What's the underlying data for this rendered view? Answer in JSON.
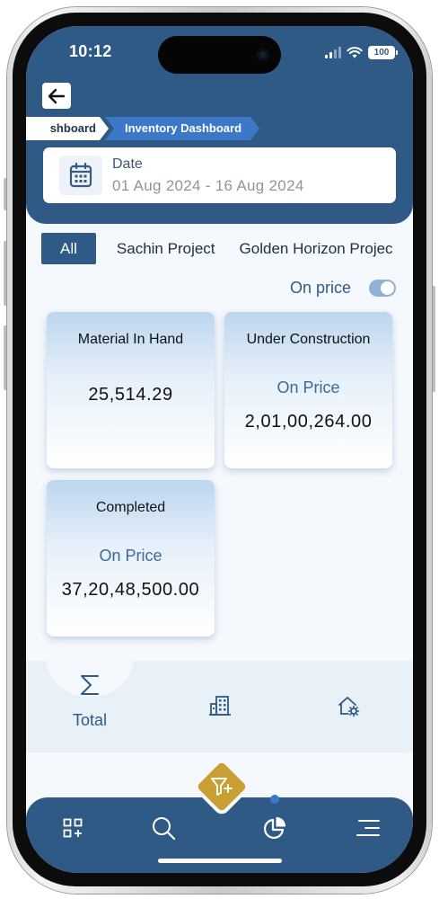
{
  "status_bar": {
    "time": "10:12",
    "battery": "100"
  },
  "breadcrumbs": {
    "previous": "shboard",
    "current": "Inventory Dashboard"
  },
  "date_filter": {
    "label": "Date",
    "range": "01 Aug 2024 - 16 Aug 2024"
  },
  "project_tabs": [
    {
      "label": "All",
      "active": true
    },
    {
      "label": "Sachin Project",
      "active": false
    },
    {
      "label": "Golden Horizon Projec",
      "active": false
    }
  ],
  "price_toggle": {
    "label": "On price",
    "on": true
  },
  "cards": {
    "material_in_hand": {
      "title": "Material In Hand",
      "value": "25,514.29"
    },
    "under_construction": {
      "title": "Under Construction",
      "subtitle": "On Price",
      "value": "2,01,00,264.00"
    },
    "completed": {
      "title": "Completed",
      "subtitle": "On Price",
      "value": "37,20,48,500.00"
    }
  },
  "sub_tabs": {
    "active_label": "Total",
    "icons": [
      "sigma-icon",
      "building-icon",
      "home-settings-icon"
    ]
  },
  "bottom_nav": {
    "icons": [
      "grid-add-icon",
      "search-icon",
      "pie-chart-icon",
      "menu-icon"
    ],
    "fab_icon": "filter-add-icon"
  },
  "colors": {
    "primary": "#2f5a86",
    "accent": "#3c78c8",
    "fab": "#c79f33"
  }
}
